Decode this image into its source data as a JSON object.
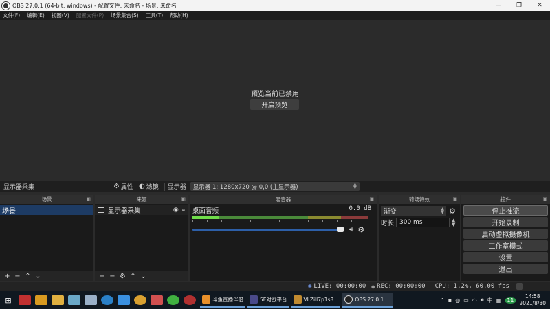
{
  "window": {
    "title": "OBS 27.0.1 (64-bit, windows) - 配置文件: 未命名 - 场景: 未命名",
    "minimize_icon": "minimize-icon",
    "maximize_icon": "restore-icon",
    "close_icon": "close-icon"
  },
  "menu": [
    {
      "label": "文件(F)",
      "disabled": false
    },
    {
      "label": "编辑(E)",
      "disabled": false
    },
    {
      "label": "视图(V)",
      "disabled": false
    },
    {
      "label": "配置文件(P)",
      "disabled": true
    },
    {
      "label": "场景集合(S)",
      "disabled": false
    },
    {
      "label": "工具(T)",
      "disabled": false
    },
    {
      "label": "帮助(H)",
      "disabled": false
    }
  ],
  "preview": {
    "message": "预览当前已禁用",
    "enable_button": "开启预览"
  },
  "source_toolbar": {
    "selected_source": "显示器采集",
    "properties_label": "属性",
    "filters_label": "滤镜",
    "display_label": "显示器",
    "display_value": "显示器 1: 1280x720 @ 0,0 (主显示器)"
  },
  "docks": {
    "scenes": {
      "title": "场景",
      "items": [
        "场景"
      ]
    },
    "sources": {
      "title": "来源",
      "items": [
        "显示器采集"
      ]
    },
    "mixer": {
      "title": "混音器",
      "tracks": [
        {
          "name": "桌面音频",
          "db": "0.0 dB",
          "level": 0.15,
          "volume": 1.0
        }
      ]
    },
    "transitions": {
      "title": "转场特效",
      "selected": "渐变",
      "duration_label": "时长",
      "duration_value": "300 ms"
    },
    "controls": {
      "title": "控件",
      "buttons": [
        "停止推流",
        "开始录制",
        "启动虚拟摄像机",
        "工作室模式",
        "设置",
        "退出"
      ]
    }
  },
  "status": {
    "live": "LIVE: 00:00:00",
    "rec": "REC: 00:00:00",
    "cpu": "CPU: 1.2%, 60.00 fps"
  },
  "taskbar": {
    "apps": [
      "斗鱼直播伴侣",
      "5E对战平台",
      "VLZill7p1s8...",
      "OBS 27.0.1 ..."
    ],
    "tray_lang": "中",
    "time": "14:58",
    "date": "2021/8/30"
  },
  "colors": {
    "accent_selected": "#1d3b64",
    "meter_level": "#6fdc4a",
    "volume_bar": "#2d5fa8"
  }
}
